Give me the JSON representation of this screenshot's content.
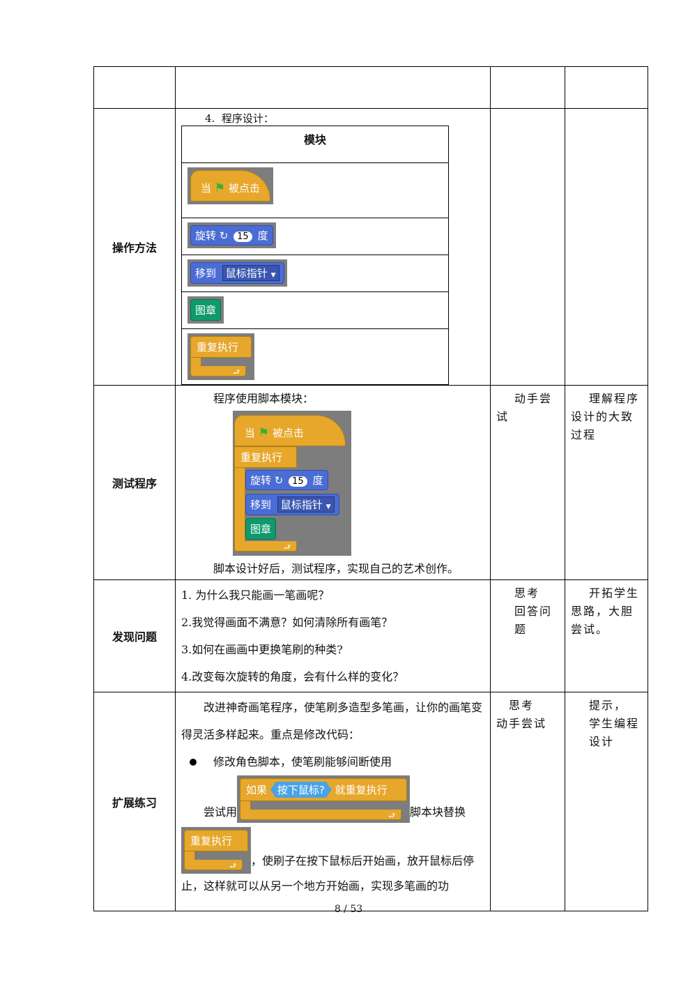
{
  "rows": {
    "blank": {},
    "operation": {
      "label": "操作方法",
      "heading": "4.  程序设计：",
      "table_header": "模块",
      "blocks": {
        "hat_when": "当",
        "hat_clicked": "被点击",
        "turn": "旋转",
        "turn_value": "15",
        "turn_unit": "度",
        "goto": "移到",
        "goto_target": "鼠标指针",
        "stamp": "图章",
        "forever": "重复执行"
      }
    },
    "test": {
      "label": "测试程序",
      "intro": "程序使用脚本模块：",
      "outro": "脚本设计好后，测试程序，实现自己的艺术创作。",
      "col3": "动手尝试",
      "col4": "理解程序设计的大致过程"
    },
    "problems": {
      "label": "发现问题",
      "items": [
        "1. 为什么我只能画一笔画呢？",
        "2.我觉得画面不满意？如何清除所有画笔？",
        "3.如何在画画中更换笔刷的种类?",
        "4.改变每次旋转的角度，会有什么样的变化？"
      ],
      "col3_line1": "思考",
      "col3_line2": "回答问题",
      "col4": "开拓学生思路，大胆尝试。"
    },
    "extend": {
      "label": "扩展练习",
      "para1": "改进神奇画笔程序，使笔刷多造型多笔画，让你的画笔变得灵活多样起来。重点是修改代码：",
      "bullet": "修改角色脚本，使笔刷能够间断使用",
      "try_use": "尝试用",
      "replace_text": "脚本块替换",
      "if_label": "如果",
      "if_condition": "按下鼠标?",
      "if_then": "就重复执行",
      "tail": "，使刷子在按下鼠标后开始画，放开鼠标后停止，这样就可以从另一个地方开始画，实现多笔画的功",
      "col3_line1": "思考",
      "col3_line2": "动手尝试",
      "col4_line1": "提示，",
      "col4_line2": "学生编程设计"
    }
  },
  "footer": {
    "page": "8 / 53"
  },
  "colors": {
    "control": "#e6a72b",
    "motion": "#4a6cd4",
    "pen": "#0e9a6c",
    "flag": "#2fb52f"
  }
}
